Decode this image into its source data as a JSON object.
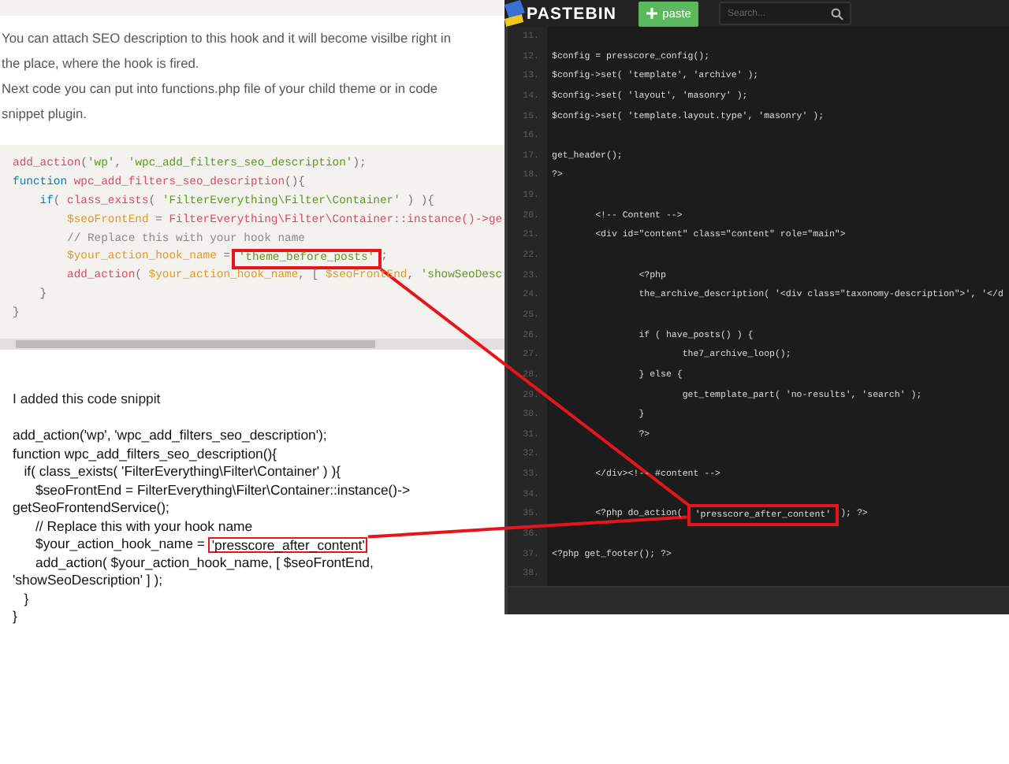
{
  "article": {
    "intro": [
      "You can attach SEO description to this hook and it will become visilbe right in\nthe place, where the hook is fired.",
      "Next code you can put into functions.php file of your child theme or in code\nsnippet plugin."
    ],
    "code_block": {
      "lines": [
        {
          "tokens": [
            {
              "kind": "fn",
              "text": "add_action"
            },
            {
              "kind": "txt",
              "text": "("
            },
            {
              "kind": "str",
              "text": "'wp'"
            },
            {
              "kind": "txt",
              "text": ", "
            },
            {
              "kind": "str",
              "text": "'wpc_add_filters_seo_description'"
            },
            {
              "kind": "txt",
              "text": ");"
            }
          ]
        },
        {
          "tokens": [
            {
              "kind": "kw",
              "text": "function"
            },
            {
              "kind": "fn",
              "text": " wpc_add_filters_seo_description"
            },
            {
              "kind": "txt",
              "text": "(){"
            }
          ]
        },
        {
          "tokens": [
            {
              "kind": "kw",
              "text": "    if"
            },
            {
              "kind": "txt",
              "text": "( "
            },
            {
              "kind": "fn",
              "text": "class_exists"
            },
            {
              "kind": "txt",
              "text": "( "
            },
            {
              "kind": "str",
              "text": "'FilterEverything\\Filter\\Container'"
            },
            {
              "kind": "txt",
              "text": " ) ){"
            }
          ]
        },
        {
          "tokens": [
            {
              "kind": "var",
              "text": "        $seoFrontEnd"
            },
            {
              "kind": "txt",
              "text": " = "
            },
            {
              "kind": "fn",
              "text": "FilterEverything\\Filter\\Container::instance()->ge"
            }
          ]
        },
        {
          "tokens": [
            {
              "kind": "cmt",
              "text": "        // Replace this with your hook name"
            }
          ]
        },
        {
          "tokens": [
            {
              "kind": "var",
              "text": "        $your_action_hook_name"
            },
            {
              "kind": "txt",
              "text": " = "
            },
            {
              "kind": "boxed",
              "text": "'theme_before_posts'"
            },
            {
              "kind": "txt",
              "text": ";"
            }
          ]
        },
        {
          "tokens": [
            {
              "kind": "fn",
              "text": "        add_action"
            },
            {
              "kind": "txt",
              "text": "( "
            },
            {
              "kind": "var",
              "text": "$your_action_hook_name"
            },
            {
              "kind": "txt",
              "text": ", [ "
            },
            {
              "kind": "var",
              "text": "$seoFrontEnd"
            },
            {
              "kind": "txt",
              "text": ", "
            },
            {
              "kind": "str",
              "text": "'showSeoDesc"
            }
          ]
        },
        {
          "tokens": [
            {
              "kind": "txt",
              "text": "    }"
            }
          ]
        },
        {
          "tokens": [
            {
              "kind": "txt",
              "text": "}"
            }
          ]
        }
      ]
    },
    "note": "I added this code snippit",
    "snippet_lines": [
      "add_action('wp', 'wpc_add_filters_seo_description');",
      "function wpc_add_filters_seo_description(){",
      "   if( class_exists( 'FilterEverything\\Filter\\Container' ) ){",
      "      $seoFrontEnd = FilterEverything\\Filter\\Container::instance()->",
      "getSeoFrontendService();",
      "      // Replace this with your hook name",
      {
        "segments": [
          {
            "kind": "plain",
            "text": "      $your_action_hook_name = "
          },
          {
            "kind": "boxed",
            "text": "'presscore_after_content'"
          }
        ]
      },
      "      add_action( $your_action_hook_name, [ $seoFrontEnd,",
      "'showSeoDescription' ] );",
      "   }",
      "}"
    ]
  },
  "pastebin": {
    "logo": "PASTEBIN",
    "paste_button": "paste",
    "search": {
      "placeholder": "Search..."
    },
    "lines": [
      {
        "number": "11."
      },
      {
        "number": "12.",
        "text": "$config = presscore_config();"
      },
      {
        "number": "13.",
        "text": "$config->set( 'template', 'archive' );"
      },
      {
        "number": "14.",
        "text": "$config->set( 'layout', 'masonry' );"
      },
      {
        "number": "15.",
        "text": "$config->set( 'template.layout.type', 'masonry' );"
      },
      {
        "number": "16."
      },
      {
        "number": "17.",
        "text": "get_header();"
      },
      {
        "number": "18.",
        "text": "?>"
      },
      {
        "number": "19."
      },
      {
        "number": "20.",
        "text": "        <!-- Content -->"
      },
      {
        "number": "21.",
        "text": "        <div id=\"content\" class=\"content\" role=\"main\">"
      },
      {
        "number": "22."
      },
      {
        "number": "23.",
        "text": "                <?php"
      },
      {
        "number": "24.",
        "text": "                the_archive_description( '<div class=\"taxonomy-description\">', '</d"
      },
      {
        "number": "25."
      },
      {
        "number": "26.",
        "text": "                if ( have_posts() ) {"
      },
      {
        "number": "27.",
        "text": "                        the7_archive_loop();"
      },
      {
        "number": "28.",
        "text": "                } else {"
      },
      {
        "number": "29.",
        "text": "                        get_template_part( 'no-results', 'search' );"
      },
      {
        "number": "30.",
        "text": "                }"
      },
      {
        "number": "31.",
        "text": "                ?>"
      },
      {
        "number": "32."
      },
      {
        "number": "33.",
        "text": "        </div><!-- #content -->"
      },
      {
        "number": "34."
      },
      {
        "number": "35.",
        "segments": [
          {
            "kind": "plain",
            "text": "        <?php do_action("
          },
          {
            "kind": "boxed",
            "text": "'presscore_after_content'"
          },
          {
            "kind": "plain",
            "text": "); ?>"
          }
        ]
      },
      {
        "number": "36."
      },
      {
        "number": "37.",
        "text": "<?php get_footer(); ?>"
      },
      {
        "number": "38."
      }
    ]
  }
}
